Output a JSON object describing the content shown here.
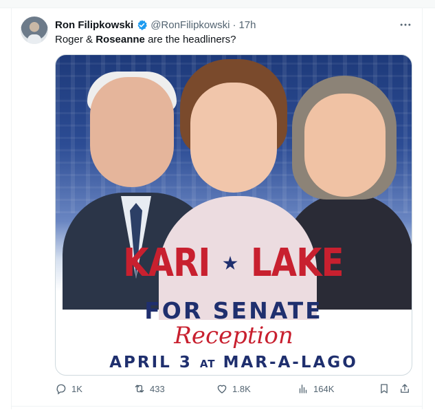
{
  "tweet": {
    "author": {
      "display_name": "Ron Filipkowski",
      "handle": "@RonFilipkowski",
      "separator": "·",
      "timestamp": "17h",
      "verified": true
    },
    "text": {
      "part1": "Roger & ",
      "bold": "Roseanne",
      "part2": " are the headliners?"
    },
    "media": {
      "poster": {
        "name_left": "KARI",
        "name_right": "LAKE",
        "line2": "FOR SENATE",
        "line3": "Reception",
        "line4_a": "APRIL 3",
        "line4_b": "AT",
        "line4_c": "MAR-A-LAGO"
      }
    },
    "actions": {
      "replies": "1K",
      "reposts": "433",
      "likes": "1.8K",
      "views": "164K"
    }
  },
  "icons": [
    "verified-badge-icon",
    "more-icon",
    "reply-icon",
    "repost-icon",
    "like-icon",
    "views-icon",
    "bookmark-icon",
    "share-icon"
  ],
  "colors": {
    "accent": "#1d9bf0",
    "secondary_text": "#536471",
    "poster_red": "#c8202f",
    "poster_navy": "#1f2f6e"
  }
}
